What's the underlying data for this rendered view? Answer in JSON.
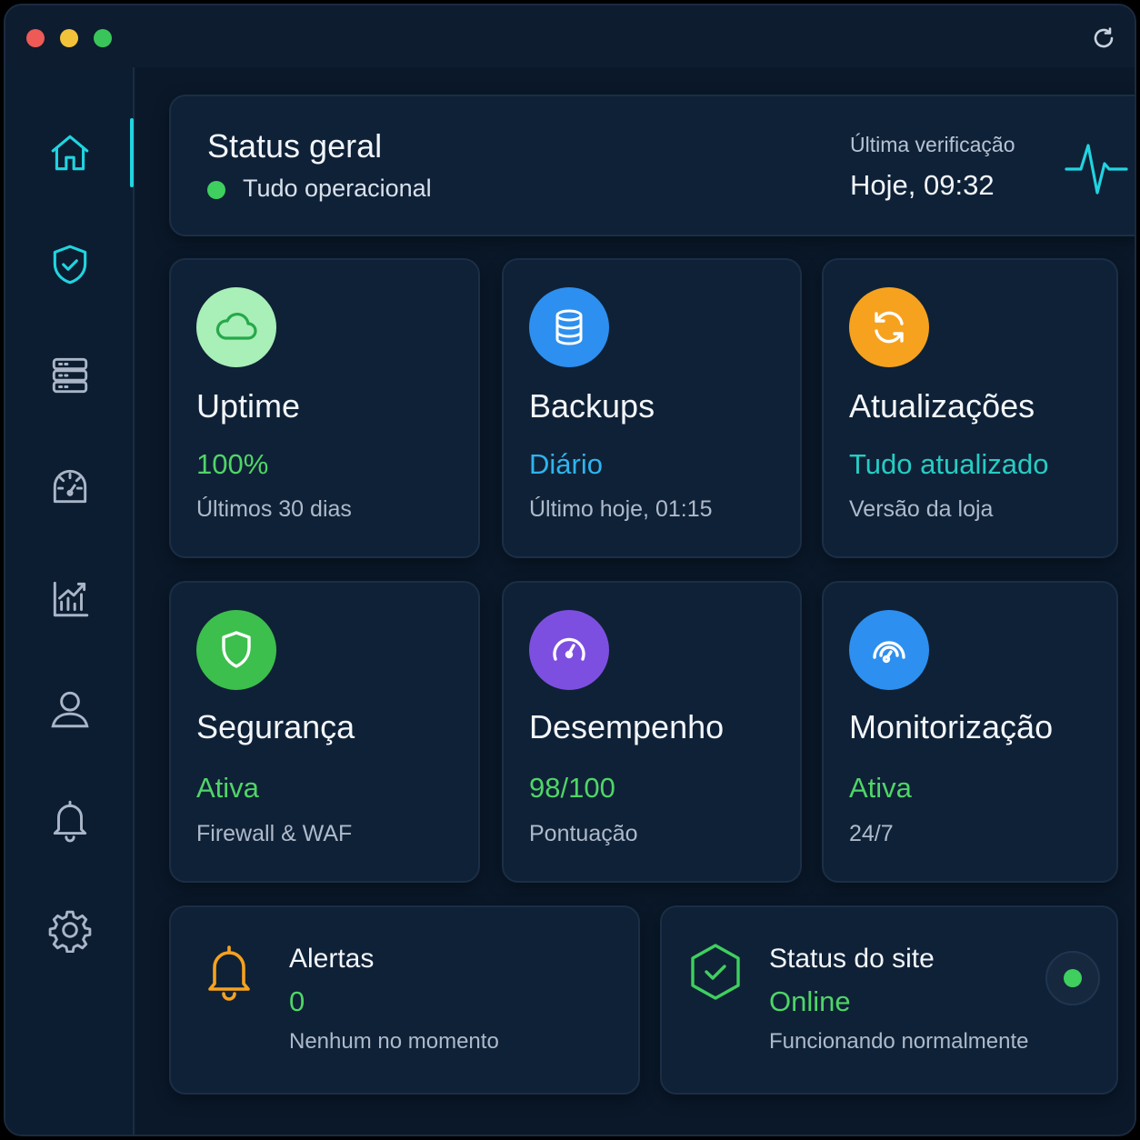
{
  "window": {
    "controls": [
      "close",
      "minimize",
      "maximize"
    ],
    "refresh_icon": "refresh-icon"
  },
  "sidebar": {
    "items": [
      {
        "icon": "home-icon",
        "active": true
      },
      {
        "icon": "shield-check-icon",
        "active": false
      },
      {
        "icon": "server-icon",
        "active": false
      },
      {
        "icon": "gauge-icon",
        "active": false
      },
      {
        "icon": "analytics-icon",
        "active": false
      },
      {
        "icon": "user-icon",
        "active": false
      },
      {
        "icon": "bell-icon",
        "active": false
      },
      {
        "icon": "gear-icon",
        "active": false
      }
    ]
  },
  "status": {
    "title": "Status geral",
    "subtitle": "Tudo operacional",
    "last_check_label": "Última verificação",
    "last_check_value": "Hoje, 09:32"
  },
  "tiles": [
    {
      "title": "Uptime",
      "value": "100%",
      "sub": "Últimos 30 dias",
      "icon": "cloud-icon"
    },
    {
      "title": "Backups",
      "value": "Diário",
      "sub": "Último hoje, 01:15",
      "icon": "database-icon"
    },
    {
      "title": "Atualizações",
      "value": "Tudo atualizado",
      "sub": "Versão da loja",
      "icon": "refresh-icon"
    },
    {
      "title": "Segurança",
      "value": "Ativa",
      "sub": "Firewall & WAF",
      "icon": "shield-icon"
    },
    {
      "title": "Desempenho",
      "value": "98/100",
      "sub": "Pontuação",
      "icon": "speedometer-icon"
    },
    {
      "title": "Monitorização",
      "value": "Ativa",
      "sub": "24/7",
      "icon": "monitoring-icon"
    }
  ],
  "alerts": {
    "title": "Alertas",
    "value": "0",
    "sub": "Nenhum no momento",
    "icon": "bell-icon"
  },
  "site_status": {
    "title": "Status do site",
    "value": "Online",
    "sub": "Funcionando normalmente",
    "icon": "hexagon-check-icon"
  },
  "colors": {
    "accent_cyan": "#21d4e0",
    "green": "#4fd567",
    "blue_text": "#2fb4ee",
    "teal_text": "#26ccc4",
    "orange": "#f6a21f"
  }
}
